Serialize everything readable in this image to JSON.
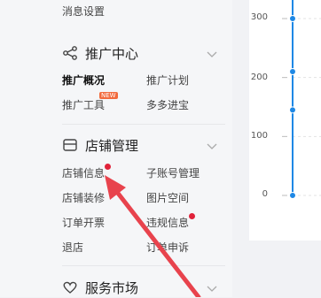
{
  "sidebar": {
    "top_item": "消息设置",
    "sections": [
      {
        "title": "推广中心",
        "icon": "share-icon",
        "items": [
          {
            "label": "推广概况",
            "active": true
          },
          {
            "label": "推广计划"
          },
          {
            "label": "推广工具",
            "badge": "NEW"
          },
          {
            "label": "多多进宝"
          }
        ]
      },
      {
        "title": "店铺管理",
        "icon": "store-icon",
        "items": [
          {
            "label": "店铺信息",
            "dot": true
          },
          {
            "label": "子账号管理"
          },
          {
            "label": "店铺装修"
          },
          {
            "label": "图片空间"
          },
          {
            "label": "订单开票"
          },
          {
            "label": "违规信息",
            "dot": true
          },
          {
            "label": "退店"
          },
          {
            "label": "订单申诉"
          }
        ]
      },
      {
        "title": "服务市场",
        "icon": "heart-icon"
      }
    ]
  },
  "chart_data": {
    "type": "line",
    "y_ticks": [
      "300",
      "200",
      "100",
      "0"
    ],
    "ylim": [
      0,
      300
    ],
    "points_y": [
      300,
      210,
      145,
      0
    ],
    "line_color": "#1e88e5"
  },
  "colors": {
    "accent": "#1e88e5",
    "dot": "#e0223a",
    "arrow": "#e8434d"
  }
}
